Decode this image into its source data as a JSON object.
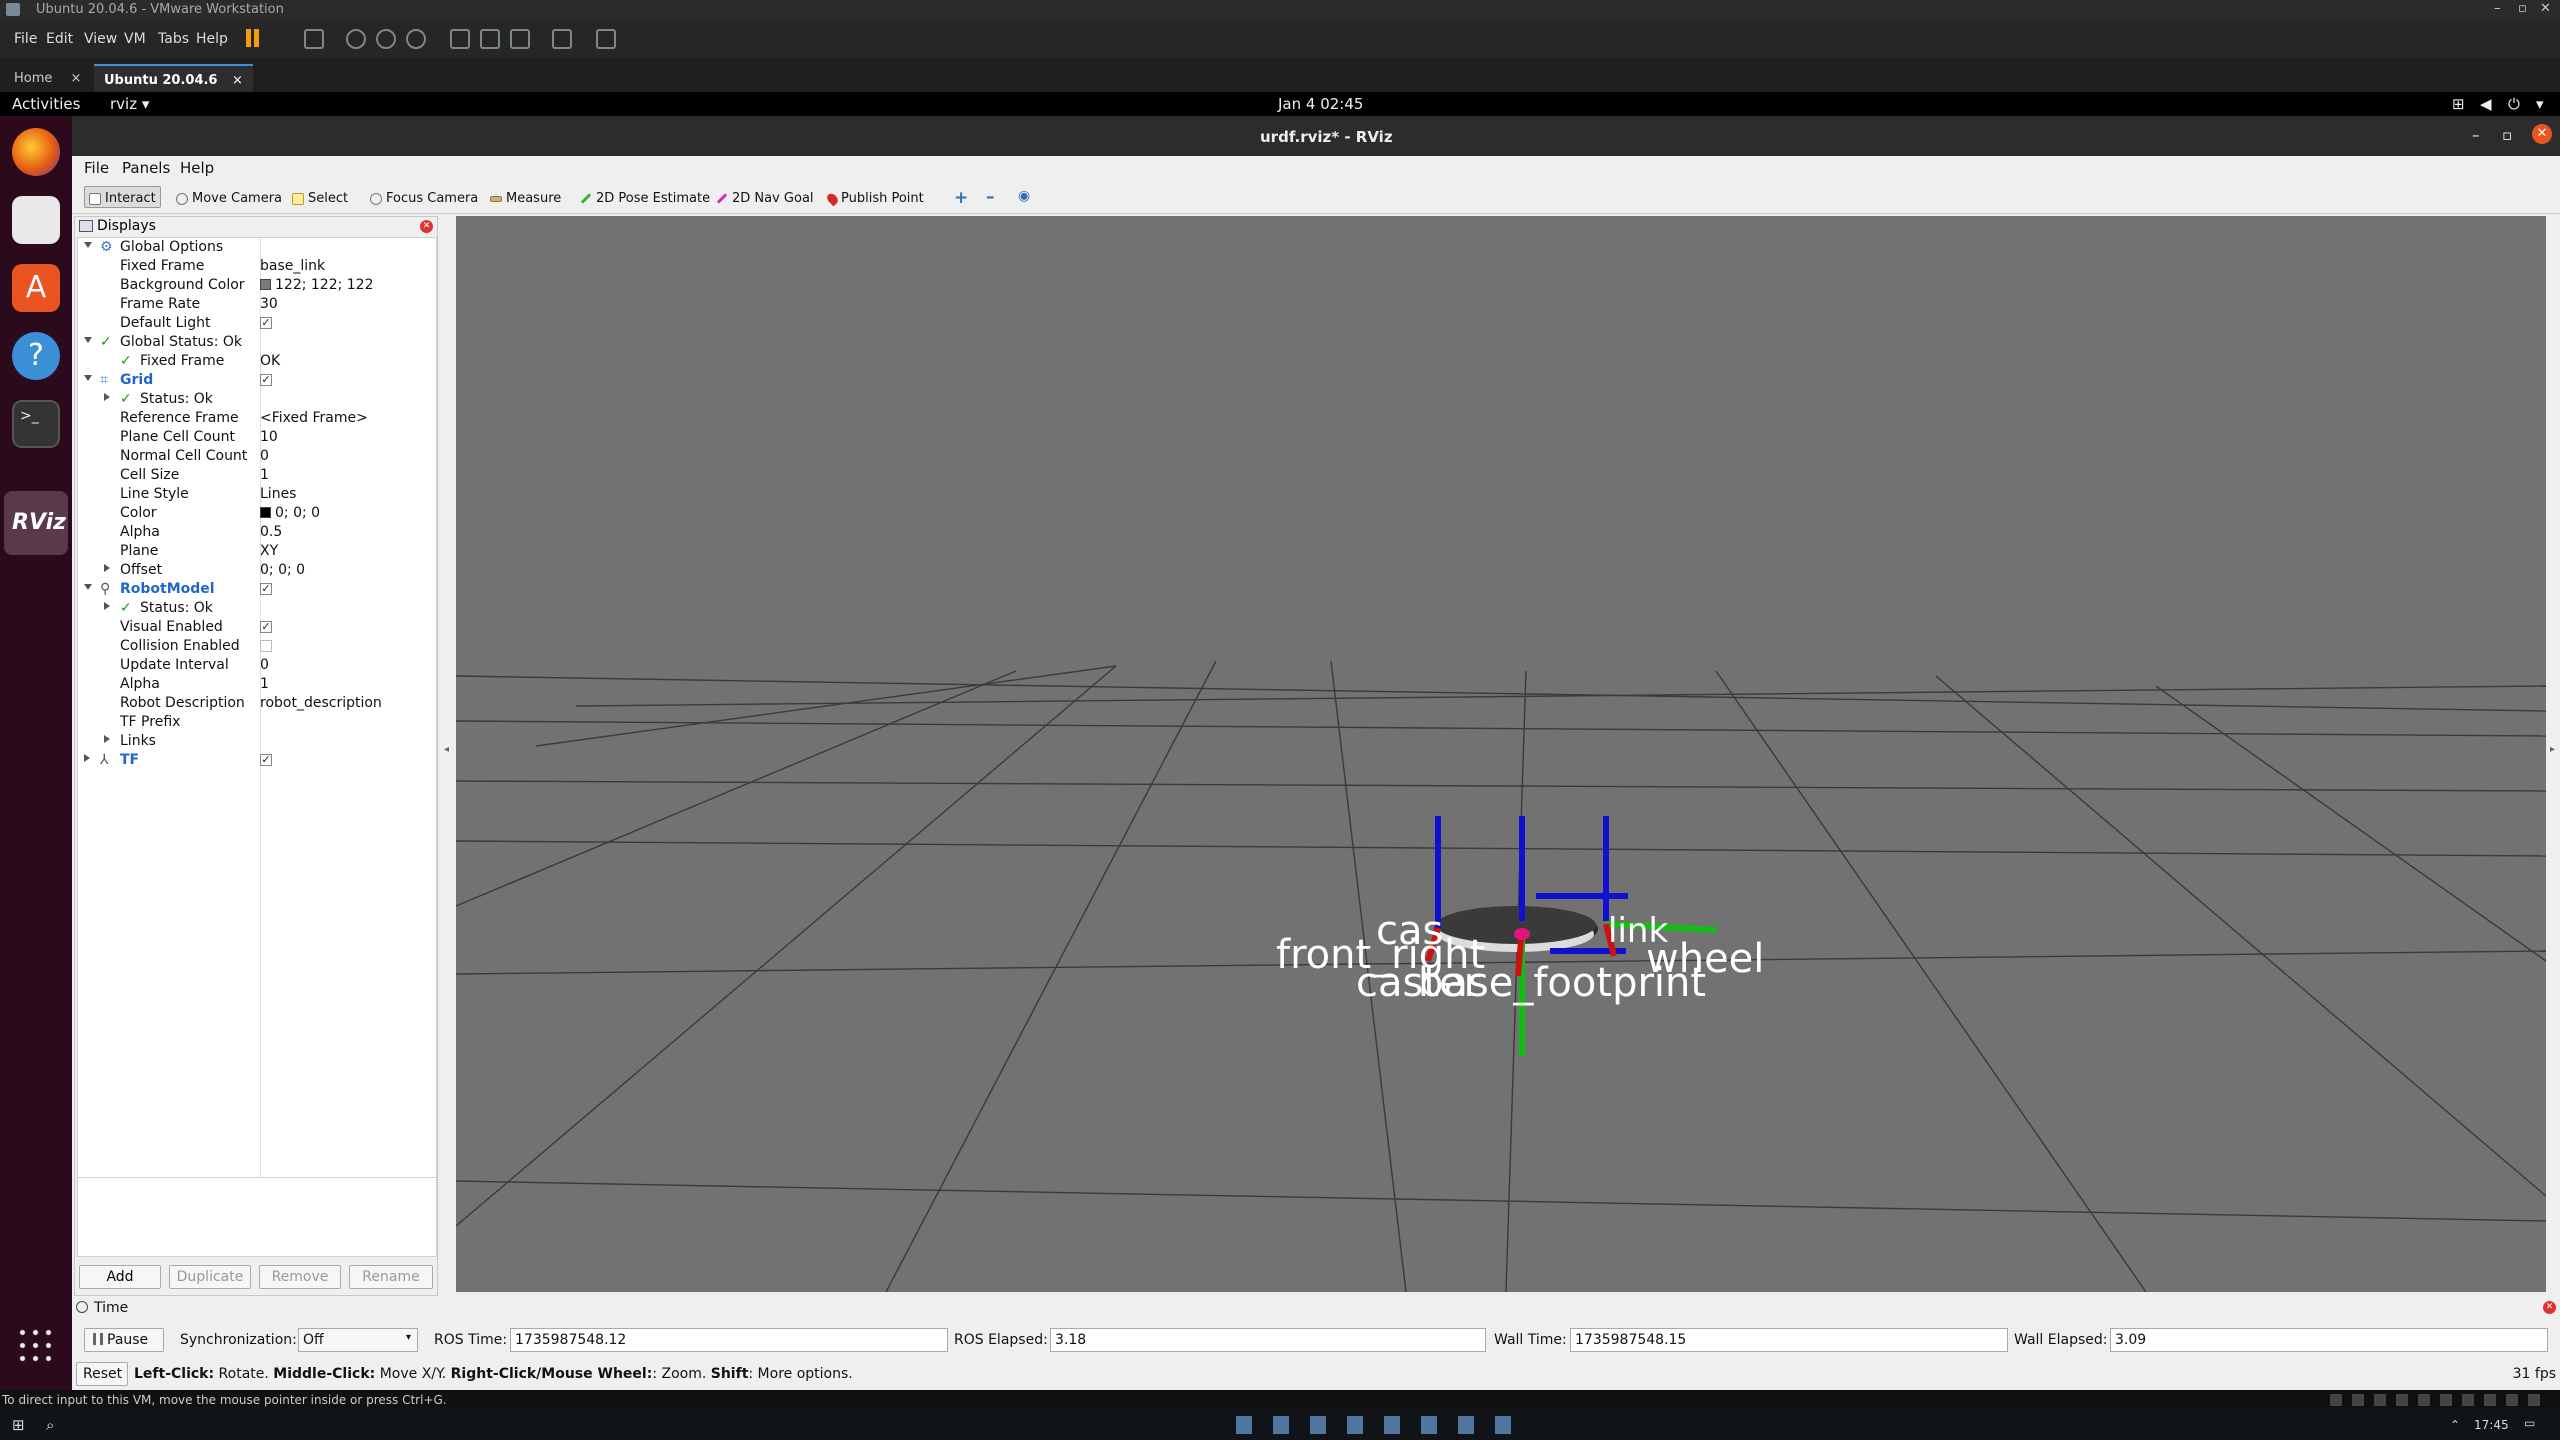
{
  "vmware": {
    "title": "Ubuntu 20.04.6 - VMware Workstation",
    "menu": [
      "File",
      "Edit",
      "View",
      "VM",
      "Tabs",
      "Help"
    ],
    "tabs": [
      {
        "label": "Home"
      },
      {
        "label": "Ubuntu 20.04.6"
      }
    ],
    "status_hint": "To direct input to this VM, move the mouse pointer inside or press Ctrl+G."
  },
  "gnome": {
    "activities": "Activities",
    "app": "rviz",
    "clock": "Jan 4  02:45"
  },
  "rviz": {
    "window_title": "urdf.rviz* - RViz",
    "menu": [
      "File",
      "Panels",
      "Help"
    ],
    "toolbar": [
      "Interact",
      "Move Camera",
      "Select",
      "Focus Camera",
      "Measure",
      "2D Pose Estimate",
      "2D Nav Goal",
      "Publish Point"
    ],
    "displays_title": "Displays",
    "tree": {
      "global_options": "Global Options",
      "fixed_frame_k": "Fixed Frame",
      "fixed_frame_v": "base_link",
      "bg_color_k": "Background Color",
      "bg_color_v": "122; 122; 122",
      "frame_rate_k": "Frame Rate",
      "frame_rate_v": "30",
      "default_light_k": "Default Light",
      "global_status": "Global Status: Ok",
      "gs_fixed_frame_k": "Fixed Frame",
      "gs_fixed_frame_v": "OK",
      "grid": "Grid",
      "grid_status": "Status: Ok",
      "ref_frame_k": "Reference Frame",
      "ref_frame_v": "<Fixed Frame>",
      "plane_cell_k": "Plane Cell Count",
      "plane_cell_v": "10",
      "normal_cell_k": "Normal Cell Count",
      "normal_cell_v": "0",
      "cell_size_k": "Cell Size",
      "cell_size_v": "1",
      "line_style_k": "Line Style",
      "line_style_v": "Lines",
      "color_k": "Color",
      "color_v": "0; 0; 0",
      "alpha_k": "Alpha",
      "alpha_v": "0.5",
      "plane_k": "Plane",
      "plane_v": "XY",
      "offset_k": "Offset",
      "offset_v": "0; 0; 0",
      "robot_model": "RobotModel",
      "rm_status": "Status: Ok",
      "visual_k": "Visual Enabled",
      "collision_k": "Collision Enabled",
      "update_k": "Update Interval",
      "update_v": "0",
      "rm_alpha_k": "Alpha",
      "rm_alpha_v": "1",
      "robot_desc_k": "Robot Description",
      "robot_desc_v": "robot_description",
      "tf_prefix_k": "TF Prefix",
      "links_k": "Links",
      "tf": "TF"
    },
    "buttons": {
      "add": "Add",
      "duplicate": "Duplicate",
      "remove": "Remove",
      "rename": "Rename"
    },
    "viewport_labels": {
      "l1": "cas",
      "l2": "link",
      "l3": "front_right",
      "l4": "wheel",
      "l5": "caster",
      "l6": "base_footprint"
    },
    "time": {
      "title": "Time",
      "pause": "Pause",
      "sync_label": "Synchronization:",
      "sync_value": "Off",
      "ros_time_label": "ROS Time:",
      "ros_time": "1735987548.12",
      "ros_elapsed_label": "ROS Elapsed:",
      "ros_elapsed": "3.18",
      "wall_time_label": "Wall Time:",
      "wall_time": "1735987548.15",
      "wall_elapsed_label": "Wall Elapsed:",
      "wall_elapsed": "3.09"
    },
    "status": {
      "reset": "Reset",
      "lc": "Left-Click:",
      "lc_t": " Rotate. ",
      "mc": "Middle-Click:",
      "mc_t": " Move X/Y. ",
      "rc": "Right-Click/Mouse Wheel:",
      "rc_t": ": Zoom. ",
      "sh": "Shift",
      "sh_t": ": More options.",
      "fps": "31 fps"
    }
  },
  "taskbar": {
    "time": "17:45"
  }
}
